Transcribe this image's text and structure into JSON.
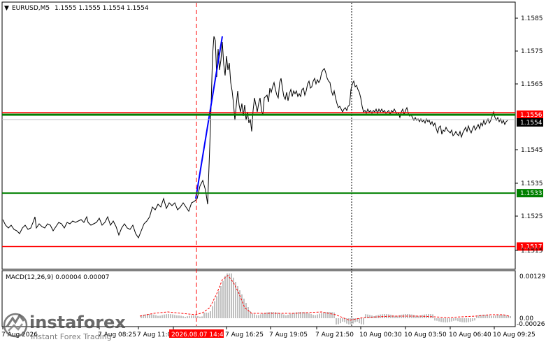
{
  "header": {
    "triangle": "▼",
    "symbol": "EURUSD,M5",
    "ohlc": "1.1555 1.1555 1.1554 1.1554"
  },
  "macd": {
    "label": "MACD(12,26,9) 0.00004 0.00007",
    "axis_labels": [
      "0.00129",
      "0.00",
      "-0.00026"
    ],
    "histogram_color": "#c0c0c0",
    "signal_color": "#ff0000"
  },
  "price_axis": {
    "labels": [
      "1.1585",
      "1.1575",
      "1.1565",
      "1.1545",
      "1.1535",
      "1.1525",
      "1.1515"
    ]
  },
  "levels": [
    {
      "name": "upper-red",
      "price": 1.1556,
      "label": "1.1556",
      "color": "#ff0000"
    },
    {
      "name": "upper-green",
      "price": 1.1555,
      "label": "",
      "color": "#008000"
    },
    {
      "name": "current",
      "price": 1.1554,
      "label": "1.1554",
      "color": "#000000"
    },
    {
      "name": "lower-green",
      "price": 1.1533,
      "label": "1.1533",
      "color": "#008000"
    },
    {
      "name": "lower-red",
      "price": 1.1517,
      "label": "1.1517",
      "color": "#ff0000"
    }
  ],
  "time_axis": {
    "labels": [
      "7 Aug 2026",
      "7 Aug 08:25",
      "7 Aug 11:0",
      "2026.08.07 14:40",
      "7 Aug 16:25",
      "7 Aug 19:05",
      "7 Aug 21:50",
      "10 Aug 00:30",
      "10 Aug 03:50",
      "10 Aug 06:40",
      "10 Aug 09:25"
    ],
    "highlight_label": "2026.08.07 14:40"
  },
  "watermark": {
    "brand": "instaforex",
    "tagline": "Instant Forex Trading"
  },
  "colors": {
    "price_line": "#000000",
    "trend_line": "#0000ff",
    "crosshair": "#ff0000",
    "separator": "#000000"
  }
}
